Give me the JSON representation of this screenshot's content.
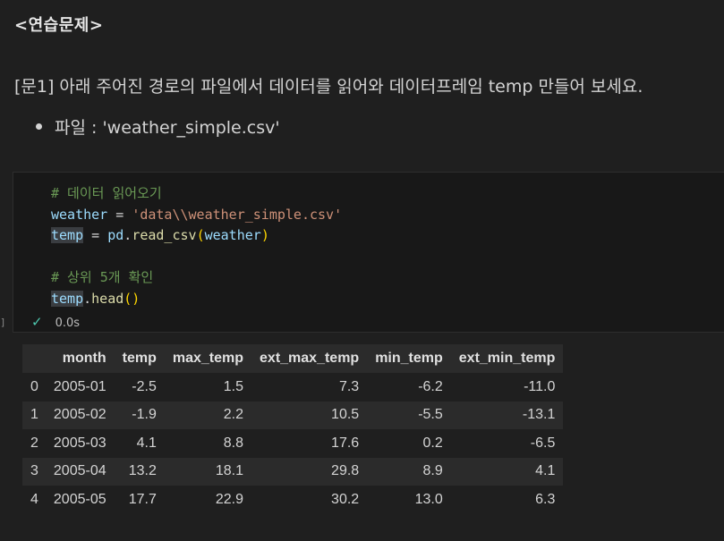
{
  "markdown": {
    "heading": "<연습문제>",
    "question": "[문1] 아래 주어진 경로의 파일에서 데이터를 읽어와 데이터프레임 temp 만들어 보세요.",
    "bullet": "파일 : 'weather_simple.csv'"
  },
  "code": {
    "comment1": "# 데이터 읽어오기",
    "line2_var": "weather",
    "line2_op": " = ",
    "line2_str": "'data\\\\weather_simple.csv'",
    "line3_var": "temp",
    "line3_op": " = ",
    "line3_obj": "pd",
    "line3_dot": ".",
    "line3_fn": "read_csv",
    "line3_open": "(",
    "line3_arg": "weather",
    "line3_close": ")",
    "comment2": "# 상위 5개 확인",
    "line6_var": "temp",
    "line6_dot": ".",
    "line6_fn": "head",
    "line6_parens": "()"
  },
  "execution": {
    "status_icon": "check-icon",
    "time": "0.0s",
    "gutter": "]"
  },
  "table": {
    "columns": [
      "",
      "month",
      "temp",
      "max_temp",
      "ext_max_temp",
      "min_temp",
      "ext_min_temp"
    ],
    "rows": [
      [
        "0",
        "2005-01",
        "-2.5",
        "1.5",
        "7.3",
        "-6.2",
        "-11.0"
      ],
      [
        "1",
        "2005-02",
        "-1.9",
        "2.2",
        "10.5",
        "-5.5",
        "-13.1"
      ],
      [
        "2",
        "2005-03",
        "4.1",
        "8.8",
        "17.6",
        "0.2",
        "-6.5"
      ],
      [
        "3",
        "2005-04",
        "13.2",
        "18.1",
        "29.8",
        "8.9",
        "4.1"
      ],
      [
        "4",
        "2005-05",
        "17.7",
        "22.9",
        "30.2",
        "13.0",
        "6.3"
      ]
    ]
  }
}
